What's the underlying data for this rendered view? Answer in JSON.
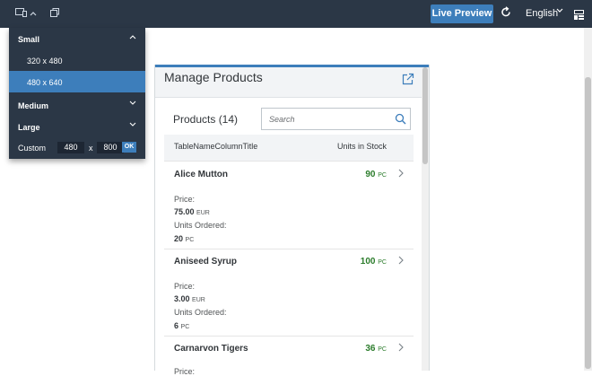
{
  "topbar": {
    "live_preview_label": "Live Preview",
    "language": "English",
    "icons": {
      "device_toggle": "device-icon",
      "rotate": "rotate-icon",
      "refresh": "refresh-icon",
      "settings": "settings-icon"
    }
  },
  "device_menu": {
    "small_label": "Small",
    "small_options": [
      "320 x 480",
      "480 x 640"
    ],
    "selected_option": "480 x 640",
    "medium_label": "Medium",
    "large_label": "Large",
    "custom_label": "Custom",
    "custom_width": "480",
    "custom_x": "x",
    "custom_height": "800",
    "ok_label": "OK"
  },
  "app": {
    "page_title": "Manage Products",
    "table_title": "Products (14)",
    "search_placeholder": "Search",
    "columns": [
      "TableNameColumnTitle",
      "Units in Stock"
    ],
    "products": [
      {
        "name": "Alice Mutton",
        "stock": "90",
        "stock_unit": "PC",
        "price_label": "Price:",
        "price": "75.00",
        "currency": "EUR",
        "ordered_label": "Units Ordered:",
        "ordered": "20",
        "ordered_unit": "PC"
      },
      {
        "name": "Aniseed Syrup",
        "stock": "100",
        "stock_unit": "PC",
        "price_label": "Price:",
        "price": "3.00",
        "currency": "EUR",
        "ordered_label": "Units Ordered:",
        "ordered": "6",
        "ordered_unit": "PC"
      },
      {
        "name": "Carnarvon Tigers",
        "stock": "36",
        "stock_unit": "PC",
        "price_label": "Price:"
      }
    ]
  },
  "colors": {
    "shell": "#2b3746",
    "accent": "#3d7ebb",
    "stock_positive": "#2b7c2b"
  }
}
